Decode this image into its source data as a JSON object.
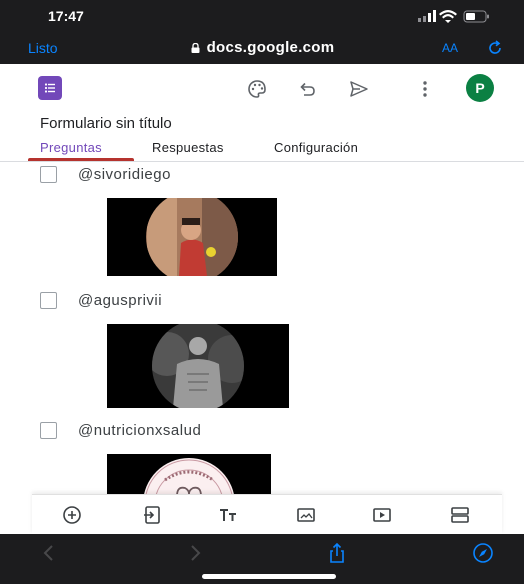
{
  "status_bar": {
    "time": "17:47"
  },
  "browser": {
    "done_label": "Listo",
    "url": "docs.google.com",
    "text_size_label": "AA"
  },
  "toolbar": {
    "avatar_letter": "P",
    "forms_color": "#7248b9",
    "avatar_color": "#0b8043"
  },
  "form": {
    "title": "Formulario sin título"
  },
  "tabs": [
    {
      "label": "Preguntas",
      "active": true
    },
    {
      "label": "Respuestas",
      "active": false
    },
    {
      "label": "Configuración",
      "active": false
    }
  ],
  "options": [
    {
      "label": "@sivoridiego"
    },
    {
      "label": "@agusprivii"
    },
    {
      "label": "@nutricionxsalud"
    }
  ],
  "bottom_tools": [
    "add-question-icon",
    "import-questions-icon",
    "add-title-icon",
    "add-image-icon",
    "add-video-icon",
    "add-section-icon"
  ],
  "colors": {
    "accent": "#7248b9",
    "tab_underline": "#b5332e",
    "ios_blue": "#0a84ff"
  }
}
